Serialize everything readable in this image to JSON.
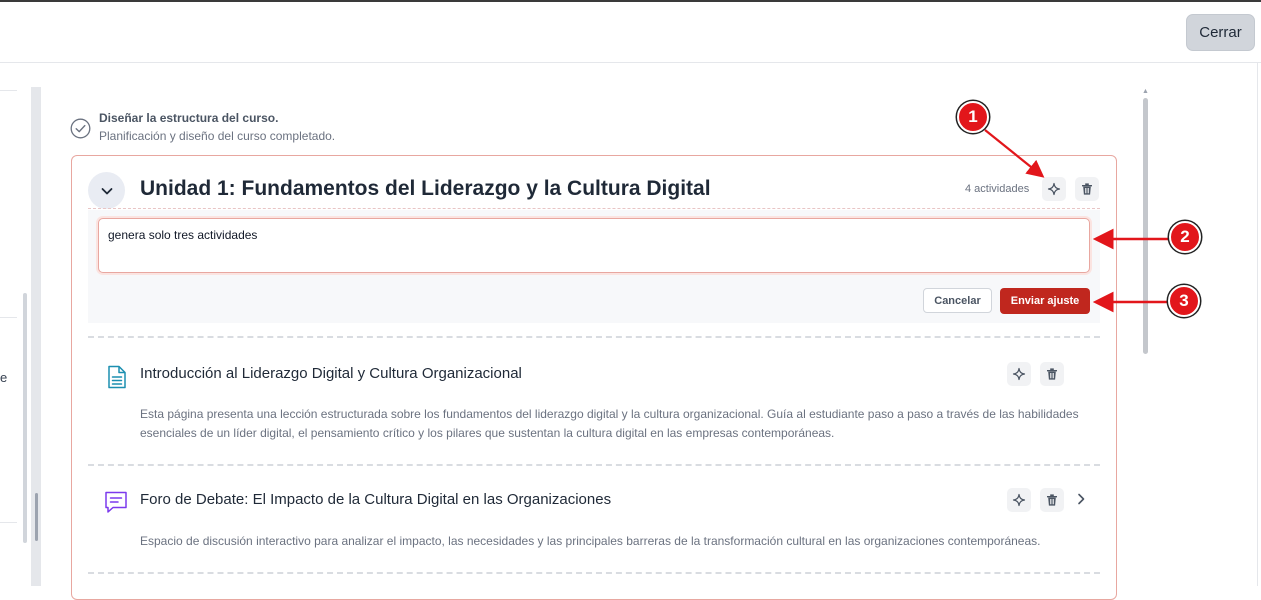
{
  "header": {
    "close_label": "Cerrar"
  },
  "left_panel": {
    "partial_letter": "e"
  },
  "task": {
    "title": "Diseñar la estructura del curso.",
    "subtitle": "Planificación y diseño del curso completado."
  },
  "unit": {
    "title": "Unidad 1: Fundamentos del Liderazgo y la Cultura Digital",
    "activity_count": "4 actividades",
    "adjust": {
      "input_value": "genera solo tres actividades",
      "cancel_label": "Cancelar",
      "send_label": "Enviar ajuste"
    },
    "activities": [
      {
        "icon": "document-icon",
        "title": "Introducción al Liderazgo Digital y Cultura Organizacional",
        "description": "Esta página presenta una lección estructurada sobre los fundamentos del liderazgo digital y la cultura organizacional. Guía al estudiante paso a paso a través de las habilidades esenciales de un líder digital, el pensamiento crítico y los pilares que sustentan la cultura digital en las empresas contemporáneas."
      },
      {
        "icon": "forum-icon",
        "title": "Foro de Debate: El Impacto de la Cultura Digital en las Organizaciones",
        "description": "Espacio de discusión interactivo para analizar el impacto, las necesidades y las principales barreras de la transformación cultural en las organizaciones contemporáneas."
      }
    ]
  },
  "annotations": {
    "a1": "1",
    "a2": "2",
    "a3": "3"
  },
  "colors": {
    "accent": "#c0271e",
    "annotation": "#e2161b",
    "card_border": "#e8a7a0"
  }
}
